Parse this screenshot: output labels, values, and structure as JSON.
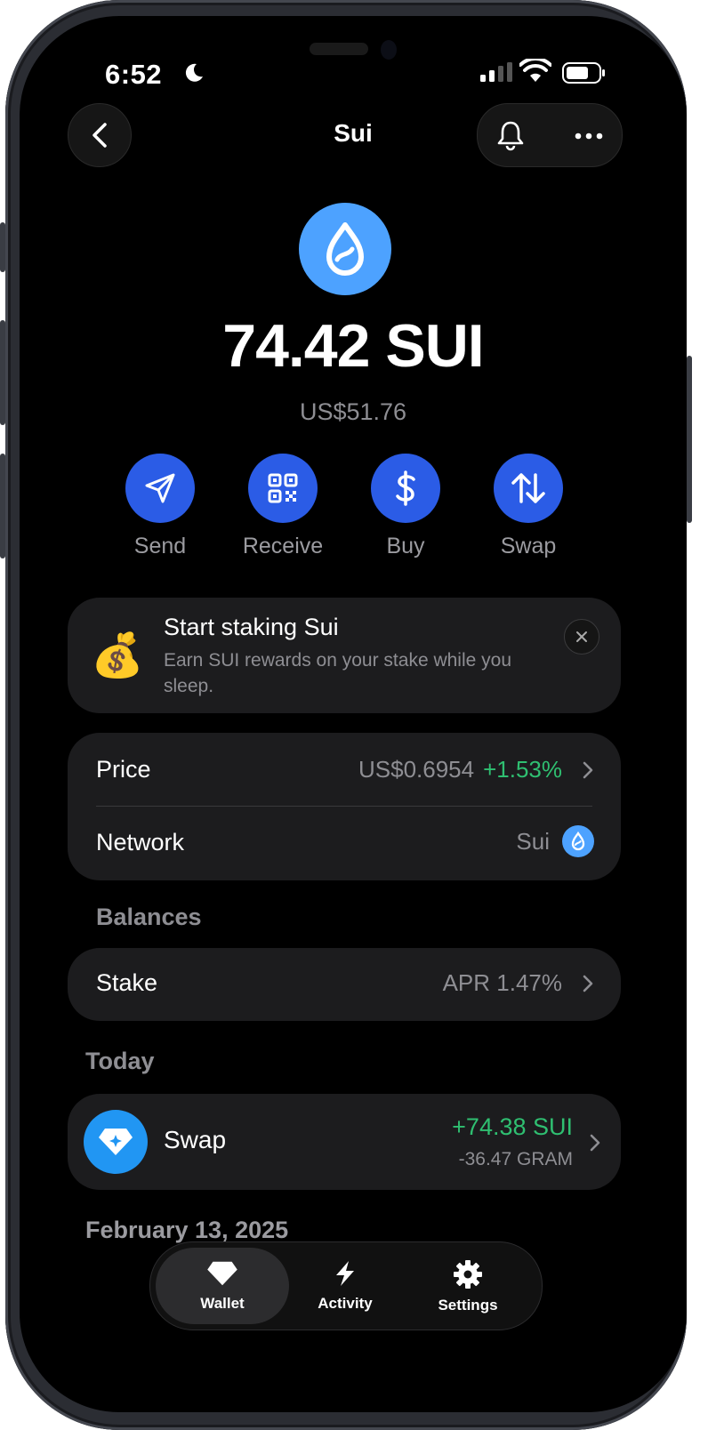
{
  "status": {
    "time": "6:52"
  },
  "header": {
    "title": "Sui"
  },
  "token": {
    "balance": "74.42 SUI",
    "fiat": "US$51.76"
  },
  "actions": [
    {
      "label": "Send",
      "icon": "send-icon"
    },
    {
      "label": "Receive",
      "icon": "qr-code-icon"
    },
    {
      "label": "Buy",
      "icon": "dollar-icon"
    },
    {
      "label": "Swap",
      "icon": "swap-arrows-icon"
    }
  ],
  "promo": {
    "emoji": "💰",
    "title": "Start staking Sui",
    "description": "Earn SUI rewards on your stake while you sleep."
  },
  "info": {
    "price_label": "Price",
    "price_value": "US$0.6954",
    "price_change": "+1.53%",
    "network_label": "Network",
    "network_value": "Sui"
  },
  "balances": {
    "heading": "Balances",
    "stake_label": "Stake",
    "stake_value": "APR 1.47%"
  },
  "activity": {
    "today_heading": "Today",
    "swap_label": "Swap",
    "swap_received": "+74.38 SUI",
    "swap_sent": "-36.47 GRAM",
    "next_date": "February 13, 2025"
  },
  "tabs": [
    {
      "label": "Wallet",
      "active": true
    },
    {
      "label": "Activity",
      "active": false
    },
    {
      "label": "Settings",
      "active": false
    }
  ],
  "colors": {
    "accent": "#2b5ce6",
    "positive": "#2fbf71",
    "sui_blue": "#4da2ff"
  }
}
